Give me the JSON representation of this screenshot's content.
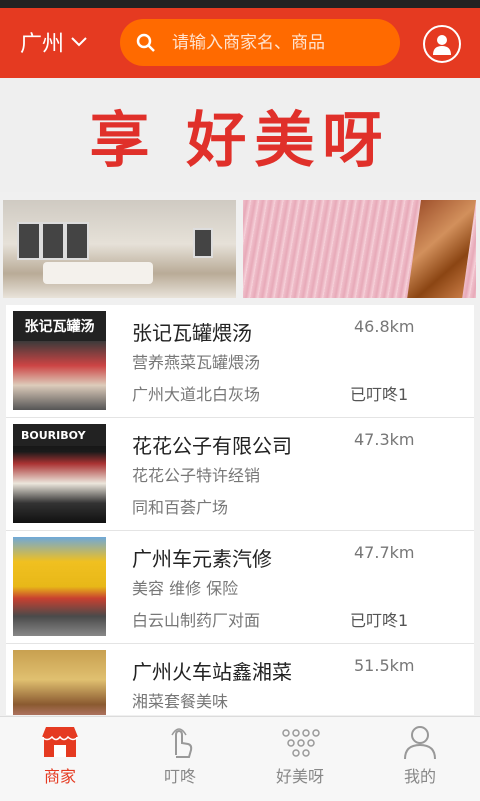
{
  "header": {
    "city": "广州",
    "search_placeholder": "请输入商家名、商品"
  },
  "banner": {
    "text": "享 好美呀"
  },
  "merchants": [
    {
      "name": "张记瓦罐煨汤",
      "distance": "46.8km",
      "desc": "营养燕菜瓦罐煨汤",
      "address": "广州大道北白灰场",
      "tag": "已叮咚1",
      "sign": "张记瓦罐汤"
    },
    {
      "name": "花花公子有限公司",
      "distance": "47.3km",
      "desc": "花花公子特许经销",
      "address": "同和百荟广场",
      "tag": "",
      "sign": "BOURIBOY"
    },
    {
      "name": "广州车元素汽修",
      "distance": "47.7km",
      "desc": "美容 维修 保险",
      "address": "白云山制药厂对面",
      "tag": "已叮咚1",
      "sign": ""
    },
    {
      "name": "广州火车站鑫湘菜",
      "distance": "51.5km",
      "desc": "湘菜套餐美味",
      "address": "",
      "tag": "",
      "sign": ""
    }
  ],
  "tabs": [
    {
      "label": "商家",
      "icon": "shop-icon",
      "active": true
    },
    {
      "label": "叮咚",
      "icon": "tap-hand-icon",
      "active": false
    },
    {
      "label": "好美呀",
      "icon": "dots-icon",
      "active": false
    },
    {
      "label": "我的",
      "icon": "person-icon",
      "active": false
    }
  ],
  "colors": {
    "header_red": "#e53a21",
    "search_orange": "#ff6a00",
    "tab_active": "#e53a21"
  }
}
